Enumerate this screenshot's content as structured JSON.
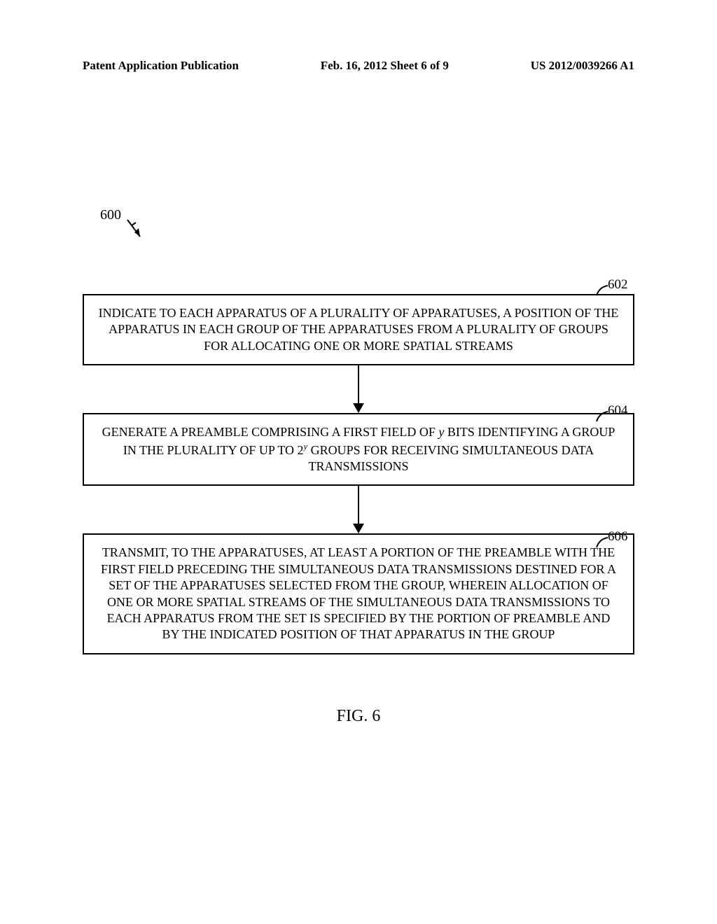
{
  "header": {
    "publication": "Patent Application Publication",
    "sheet": "Feb. 16, 2012  Sheet 6 of 9",
    "doc_number": "US 2012/0039266 A1"
  },
  "refs": {
    "flow": "600",
    "box1": "602",
    "box2": "604",
    "box3": "606"
  },
  "boxes": {
    "0": "INDICATE TO EACH APPARATUS OF A PLURALITY OF APPARATUSES, A POSITION OF THE APPARATUS IN EACH GROUP OF THE APPARATUSES FROM A PLURALITY OF GROUPS FOR ALLOCATING ONE OR MORE SPATIAL STREAMS",
    "1": {
      "pre": "GENERATE A PREAMBLE COMPRISING A FIRST FIELD OF ",
      "y1": "y",
      "mid1": " BITS IDENTIFYING A GROUP IN THE PLURALITY OF UP TO ",
      "base": "2",
      "exp": "y",
      "post": " GROUPS FOR RECEIVING SIMULTANEOUS DATA TRANSMISSIONS"
    },
    "2": "TRANSMIT, TO THE APPARATUSES, AT LEAST A PORTION OF THE PREAMBLE WITH THE FIRST FIELD PRECEDING THE SIMULTANEOUS DATA TRANSMISSIONS DESTINED FOR A SET OF THE APPARATUSES SELECTED FROM THE GROUP, WHEREIN ALLOCATION OF ONE OR MORE SPATIAL STREAMS OF THE SIMULTANEOUS DATA TRANSMISSIONS TO EACH APPARATUS FROM THE SET IS SPECIFIED BY THE PORTION OF PREAMBLE AND BY THE INDICATED POSITION OF THAT APPARATUS IN THE GROUP"
  },
  "figure_label": "FIG. 6"
}
